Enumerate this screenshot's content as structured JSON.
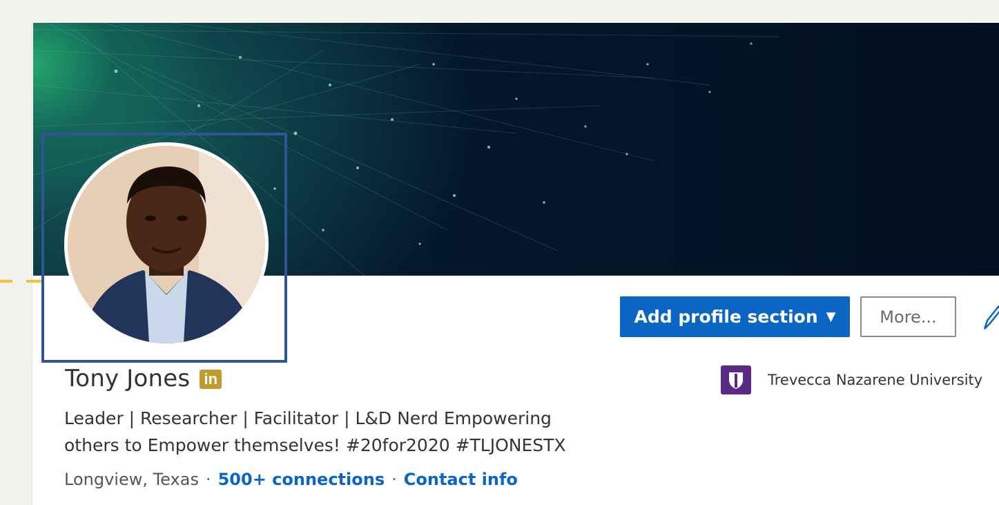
{
  "profile": {
    "name": "Tony Jones",
    "badge": "in",
    "headline_line1": "Leader | Researcher | Facilitator | L&D Nerd Empowering",
    "headline_line2": "others to Empower themselves! #20for2020 #TLJONESTX",
    "location": "Longview, Texas",
    "separator": "·",
    "connections": "500+ connections",
    "contact": "Contact info"
  },
  "actions": {
    "add_section": "Add profile section",
    "add_section_caret": "▼",
    "more": "More...",
    "edit_icon": "pencil-icon"
  },
  "education": {
    "school": "Trevecca Nazarene University",
    "logo_icon": "university-shield-icon"
  },
  "colors": {
    "primary": "#0a66c2",
    "highlight_box": "#2f5596",
    "annotation_dash": "#f1c232",
    "linkedin_badge": "#c29b2f",
    "school_logo": "#5b2a86"
  }
}
